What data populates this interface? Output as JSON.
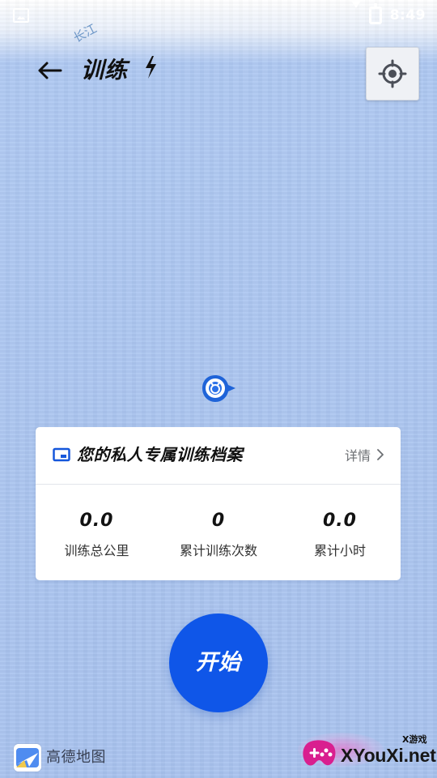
{
  "status_bar": {
    "time": "8:49"
  },
  "header": {
    "title": "训练",
    "map_label": "长江"
  },
  "profile_card": {
    "title": "您的私人专属训练档案",
    "details_label": "详情",
    "stats": [
      {
        "value": "0.0",
        "label": "训练总公里"
      },
      {
        "value": "0",
        "label": "累计训练次数"
      },
      {
        "value": "0.0",
        "label": "累计小时"
      }
    ]
  },
  "start_button": {
    "label": "开始"
  },
  "footer": {
    "map_provider": "高德地图"
  },
  "watermark": {
    "small": "X游戏",
    "brand": "XYouXi.net"
  },
  "icons": {
    "back": "arrow-left-icon",
    "bolt": "lightning-bolt-icon",
    "locate": "crosshair-icon",
    "folder": "folder-icon",
    "chevron": "chevron-right-icon",
    "marker": "location-marker-icon",
    "map_logo": "map-logo-icon",
    "gamepad": "gamepad-icon"
  },
  "colors": {
    "accent": "#0f56e8",
    "map_background": "#a8c2ee",
    "card_background": "#ffffff"
  }
}
